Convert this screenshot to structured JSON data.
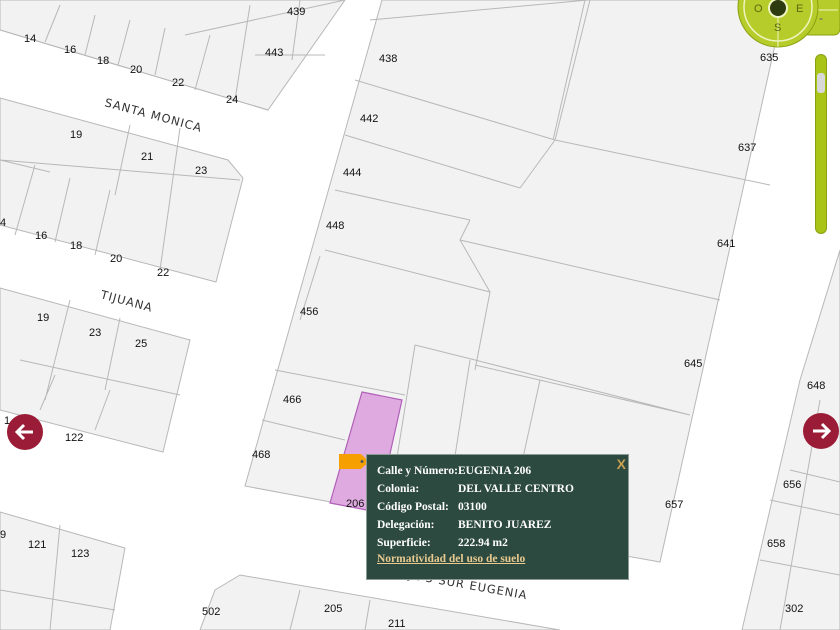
{
  "map": {
    "colors": {
      "parcel": "#f2f2f2",
      "parcel_line": "#b8b8b8",
      "selected": "#dfaadf",
      "selected_line": "#b060b8",
      "nav": "#9a1c36",
      "control": "#b5cc2a"
    },
    "street_names": [
      "SANTA MONICA",
      "TIJUANA",
      "EJE 5 SUR EUGENIA"
    ],
    "lot_numbers": [
      "439",
      "14",
      "16",
      "18",
      "20",
      "22",
      "24",
      "443",
      "438",
      "635",
      "442",
      "637",
      "19",
      "21",
      "23",
      "444",
      "4",
      "16",
      "18",
      "20",
      "22",
      "448",
      "641",
      "19",
      "23",
      "25",
      "456",
      "645",
      "648",
      "466",
      "122",
      "1",
      "468",
      "206",
      "657",
      "656",
      "9",
      "121",
      "123",
      "658",
      "502",
      "205",
      "211",
      "302"
    ]
  },
  "controls": {
    "compass": {
      "west": "O",
      "east": "E",
      "south": "S"
    },
    "zoom_level": 0.9,
    "prev_icon": "arrow-left-icon",
    "next_icon": "arrow-right-icon"
  },
  "popup": {
    "fields": [
      {
        "label": "Calle y Número:",
        "value": "EUGENIA 206"
      },
      {
        "label": "Colonia:",
        "value": "DEL VALLE CENTRO"
      },
      {
        "label": "Código Postal:",
        "value": "03100"
      },
      {
        "label": "Delegación:",
        "value": "BENITO JUAREZ"
      },
      {
        "label": "Superficie:",
        "value": "222.94 m2"
      }
    ],
    "link": "Normatividad del uso de suelo",
    "close": "X"
  }
}
